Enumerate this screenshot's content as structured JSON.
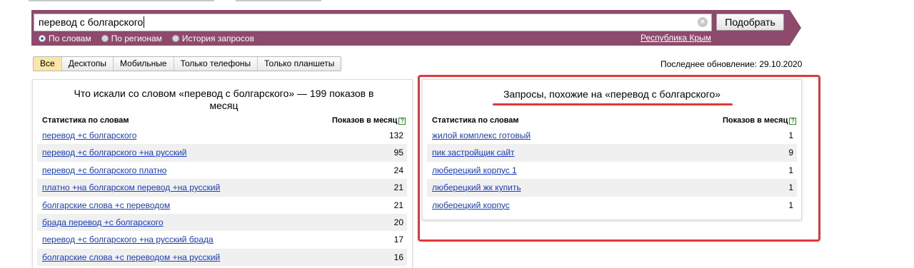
{
  "search": {
    "query": "перевод с болгарского",
    "submit_label": "Подобрать",
    "modes": [
      {
        "label": "По словам",
        "selected": true
      },
      {
        "label": "По регионам",
        "selected": false
      },
      {
        "label": "История запросов",
        "selected": false
      }
    ],
    "region": "Республика Крым"
  },
  "filters": {
    "tabs": [
      "Все",
      "Десктопы",
      "Мобильные",
      "Только телефоны",
      "Только планшеты"
    ],
    "active_tab": "Все"
  },
  "last_update": "Последнее обновление: 29.10.2020",
  "left_panel": {
    "title": "Что искали со словом «перевод с болгарского» — 199 показов в месяц",
    "col_phrase": "Статистика по словам",
    "col_count": "Показов в месяц",
    "rows": [
      {
        "phrase": "перевод +с болгарского",
        "count": "132"
      },
      {
        "phrase": "перевод +с болгарского +на русский",
        "count": "95"
      },
      {
        "phrase": "перевод +с болгарского платно",
        "count": "24"
      },
      {
        "phrase": "платно +на болгарском перевод +на русский",
        "count": "21"
      },
      {
        "phrase": "болгарские слова +с переводом",
        "count": "21"
      },
      {
        "phrase": "брада перевод +с болгарского",
        "count": "20"
      },
      {
        "phrase": "перевод +с болгарского +на русский брада",
        "count": "17"
      },
      {
        "phrase": "болгарские слова +с переводом +на русский",
        "count": "16"
      }
    ]
  },
  "right_panel": {
    "title": "Запросы, похожие на «перевод с болгарского»",
    "col_phrase": "Статистика по словам",
    "col_count": "Показов в месяц",
    "rows": [
      {
        "phrase": "жилой комплекс готовый",
        "count": "1"
      },
      {
        "phrase": "пик застройщик сайт",
        "count": "9"
      },
      {
        "phrase": "люберецкий корпус 1",
        "count": "1"
      },
      {
        "phrase": "люберецкий жк купить",
        "count": "1"
      },
      {
        "phrase": "люберецкий корпус",
        "count": "1"
      }
    ]
  },
  "colors": {
    "band": "#8d4a6c",
    "link": "#1a3dc1",
    "highlight": "#e0383b",
    "active_tab": "#fbe6a6"
  }
}
